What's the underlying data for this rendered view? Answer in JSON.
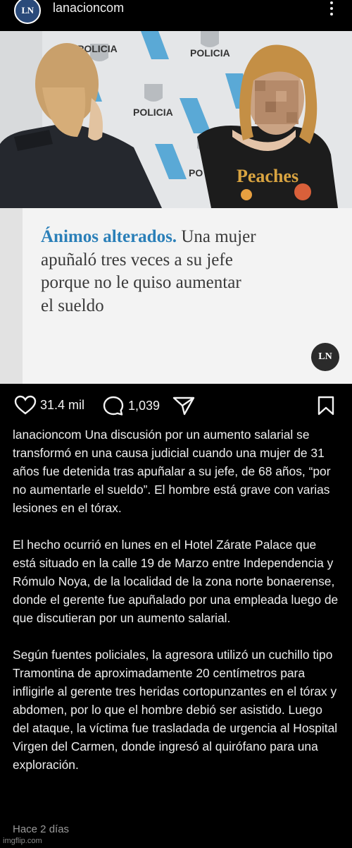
{
  "header": {
    "avatar_text": "LN",
    "username": "lanacioncom"
  },
  "media": {
    "photo_signs": [
      "POLICIA",
      "POLICIA",
      "POLICIA",
      "PO"
    ],
    "shirt_text": "Peaches",
    "headline_kicker": "Ánimos alterados.",
    "headline_lines": [
      "Una mujer",
      "apuñaló tres veces a su jefe",
      "porque no le quiso aumentar",
      "el sueldo"
    ],
    "badge_text": "LN"
  },
  "actions": {
    "likes": "31.4 mil",
    "comments": "1,039"
  },
  "caption": {
    "username": "lanacioncom",
    "paragraph1": "Una discusión por un aumento salarial se transformó en una causa judicial cuando una mujer de 31 años fue detenida tras apuñalar a su jefe, de 68 años, “por no aumentarle el sueldo”. El hombre está grave con varias lesiones en el tórax.",
    "paragraph2": "El hecho ocurrió en lunes en el Hotel Zárate Palace que está situado en la calle 19 de Marzo entre Independencia y Rómulo Noya, de la localidad de la zona norte bonaerense, donde el gerente fue apuñalado por una empleada luego de que discutieran por un aumento salarial.",
    "paragraph3": "Según fuentes policiales, la agresora utilizó un cuchillo tipo Tramontina de aproximadamente 20 centímetros para infligirle al gerente tres heridas cortopunzantes en el tórax y abdomen, por lo que el hombre debió ser asistido. Luego del ataque, la víctima fue trasladada de urgencia al Hospital Virgen del Carmen, donde ingresó al quirófano para una exploración."
  },
  "timestamp": "Hace 2 días",
  "watermark": "imgflip.com",
  "colors": {
    "background": "#000000",
    "kicker": "#2a7fb8",
    "panel": "#f3f3f3",
    "muted": "#9a9a9a"
  }
}
